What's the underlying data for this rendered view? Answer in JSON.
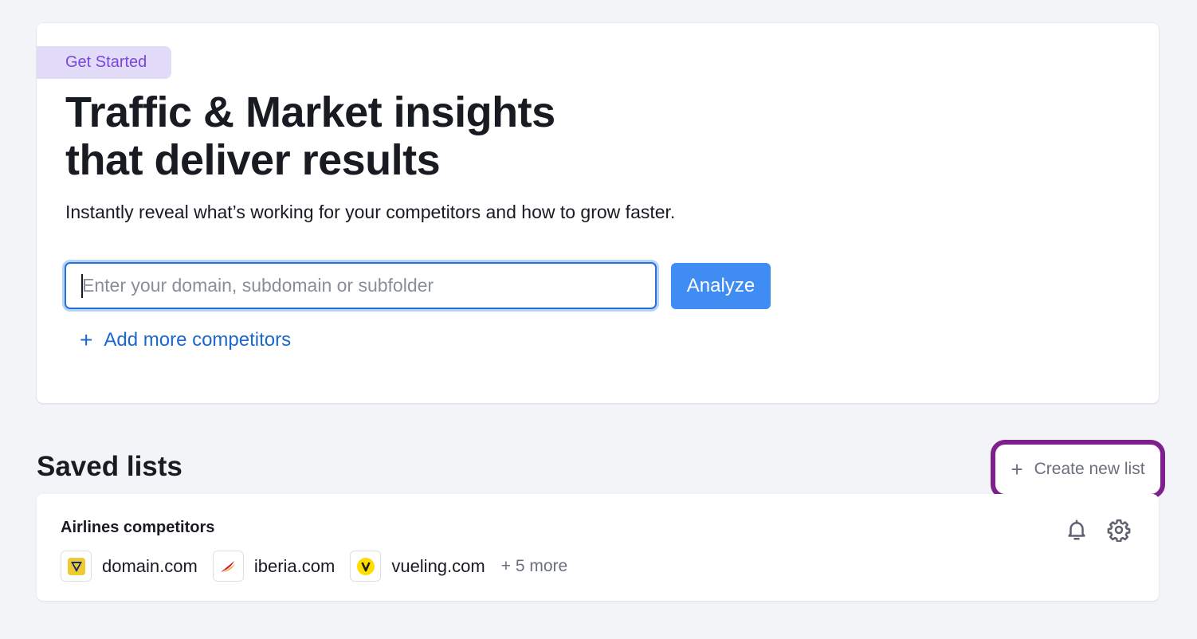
{
  "hero": {
    "badge": "Get Started",
    "title_line1": "Traffic & Market insights",
    "title_line2": "that deliver results",
    "subtitle": "Instantly reveal what’s working for your competitors and how to grow faster.",
    "input_placeholder": "Enter your domain, subdomain or subfolder",
    "input_value": "",
    "analyze_label": "Analyze",
    "add_competitors_label": "Add more competitors",
    "add_competitors_icon": "plus-icon"
  },
  "saved_lists": {
    "title": "Saved lists",
    "create_label": "Create new list",
    "create_icon": "plus-icon",
    "lists": [
      {
        "name": "Airlines competitors",
        "domains": [
          {
            "name": "domain.com",
            "icon": "ryanair-harp-icon"
          },
          {
            "name": "iberia.com",
            "icon": "iberia-logo-icon"
          },
          {
            "name": "vueling.com",
            "icon": "vueling-v-icon"
          }
        ],
        "more": "+ 5 more",
        "actions": [
          "bell-icon",
          "gear-icon"
        ]
      }
    ]
  },
  "colors": {
    "background": "#f3f4f8",
    "badge_bg": "#e3dcf9",
    "badge_text": "#7a44e0",
    "primary": "#3f8cf2",
    "link": "#1a68d0",
    "highlight_border": "#7d1f8c"
  }
}
